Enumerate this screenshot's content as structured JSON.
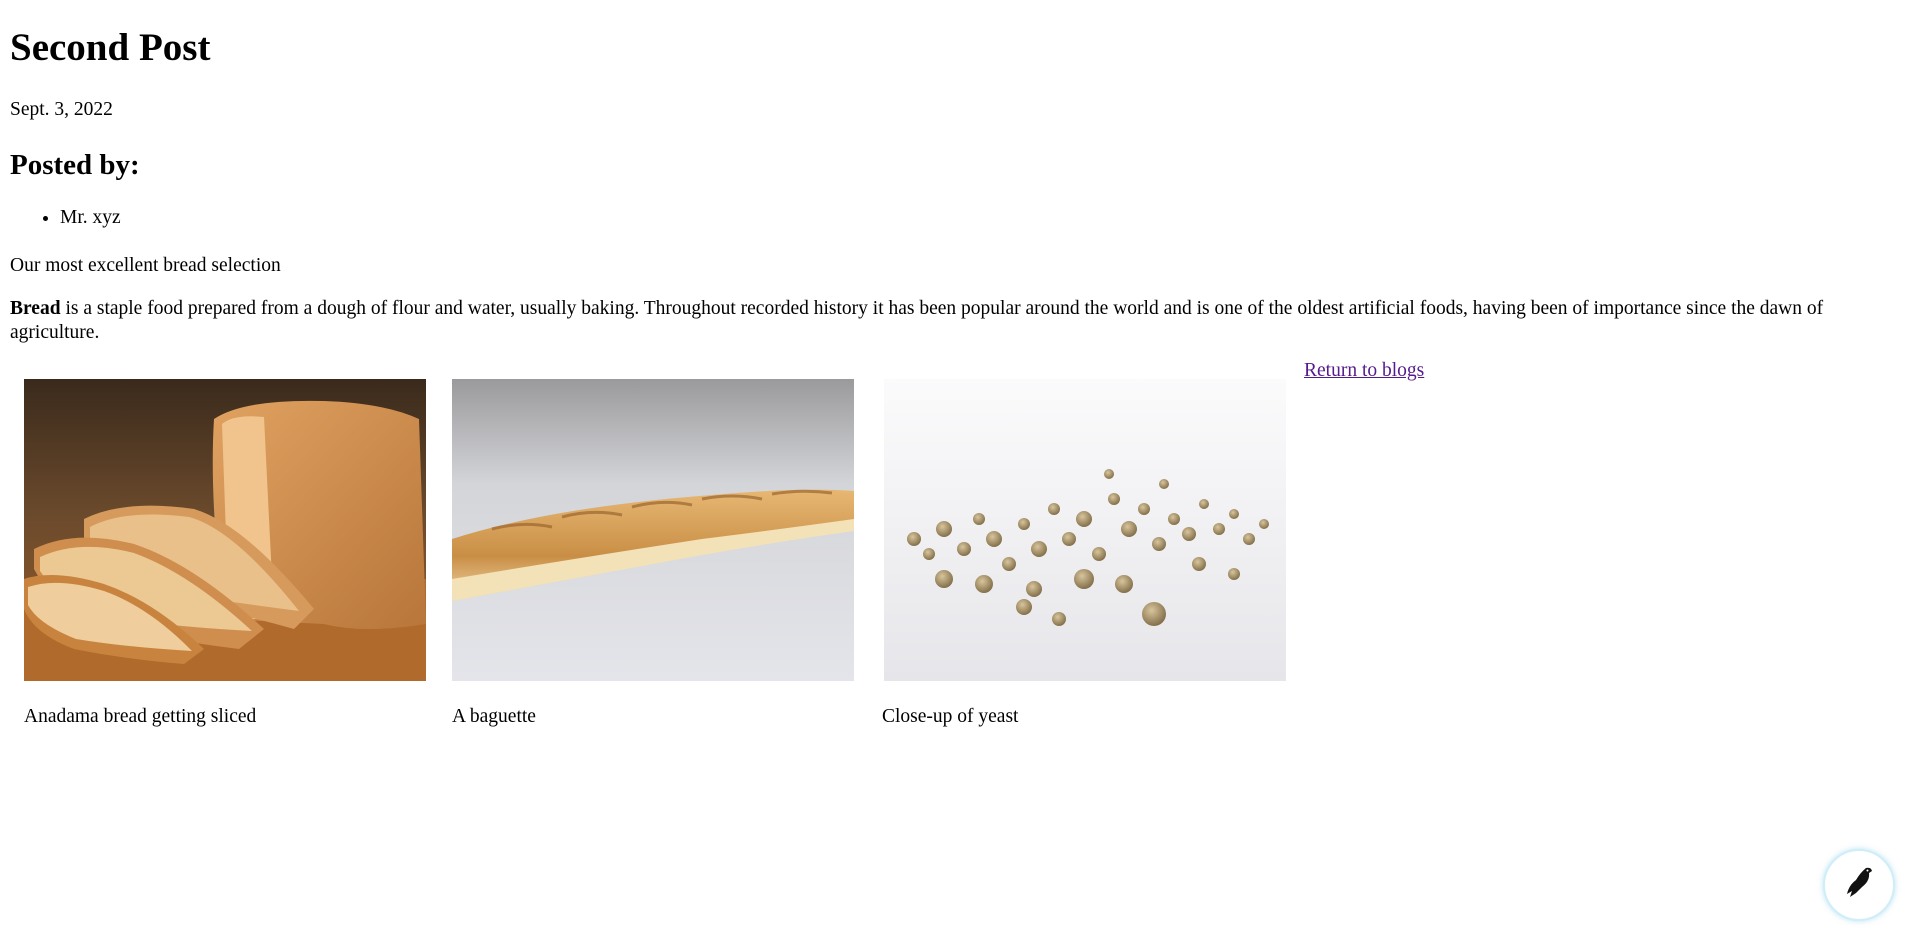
{
  "post": {
    "title": "Second Post",
    "date": "Sept. 3, 2022",
    "posted_by_heading": "Posted by:",
    "authors": [
      "Mr. xyz"
    ],
    "tagline": "Our most excellent bread selection",
    "body_bold": "Bread",
    "body_rest": " is a staple food prepared from a dough of flour and water, usually baking. Throughout recorded history it has been popular around the world and is one of the oldest artificial foods, having been of importance since the dawn of agriculture."
  },
  "gallery": [
    {
      "caption": "Anadama bread getting sliced"
    },
    {
      "caption": "A baguette"
    },
    {
      "caption": "Close-up of yeast"
    }
  ],
  "return_link": "Return to blogs",
  "fab": {
    "icon": "bird-icon"
  }
}
